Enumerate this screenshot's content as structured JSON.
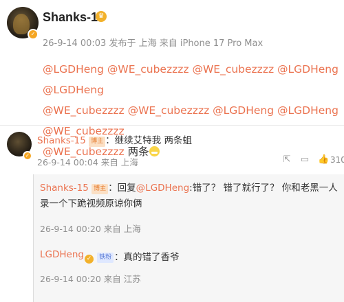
{
  "post": {
    "author": "Shanks-15",
    "meta": "26-9-14 00:03  发布于 上海  来自 iPhone 17 Pro Max",
    "lines": [
      [
        "@LGDHeng",
        " ",
        "@WE_cubezzzz",
        " ",
        "@WE_cubezzzz",
        " ",
        "@LGDHeng",
        " ",
        "@LGDHeng"
      ],
      [
        "@WE_cubezzzz",
        " ",
        "@WE_cubezzzz",
        " ",
        "@LGDHeng",
        " ",
        "@LGDHeng",
        " ",
        "@WE_cubezzzz"
      ],
      [
        "@WE_cubezzzz"
      ]
    ],
    "tail_text": " 两条"
  },
  "comment": {
    "author": "Shanks-15",
    "badge": "博主",
    "text": "：继续艾特我 两条蛆",
    "meta": "26-9-14 00:04 来自 上海",
    "like_count": "310"
  },
  "replies": [
    {
      "author": "Shanks-15",
      "badge": "博主",
      "prefix": "：回复",
      "mention": "@LGDHeng",
      "text": ":错了？ 错了就行了？ 你和老黑一人录一个下跪视频原谅你俩",
      "meta": "26-9-14 00:20 来自 上海"
    },
    {
      "author": "LGDHeng",
      "badge": "铁粉",
      "text": "：真的错了香爷",
      "meta": "26-9-14 00:20 来自 江苏"
    }
  ],
  "colors": {
    "mention": "#eb7350",
    "meta": "#8f8f8f",
    "reply_bg": "#f6f6f6"
  }
}
